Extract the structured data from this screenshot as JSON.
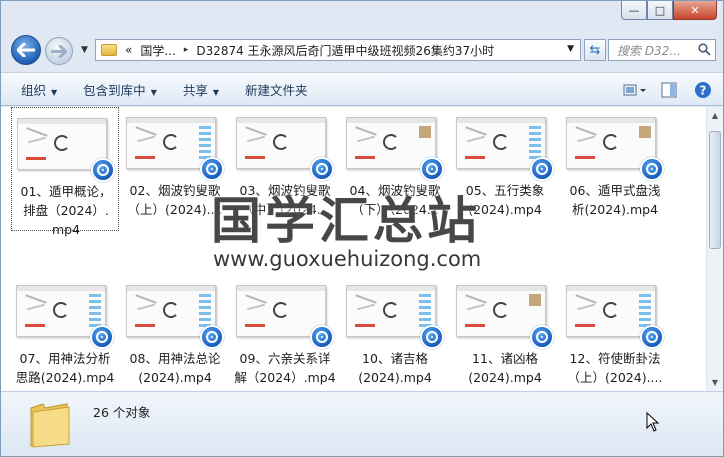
{
  "window": {
    "caption": {
      "minimize": "—",
      "maximize": "□",
      "close": "✕"
    }
  },
  "navigation": {
    "address_segments": [
      "«",
      "国学...",
      "▸",
      "D32874 王永源风后奇门遁甲中级班视频26集约37小时"
    ],
    "search_placeholder": "搜索 D32..."
  },
  "commandbar": {
    "items": [
      {
        "label": "组织",
        "caret": true
      },
      {
        "label": "包含到库中",
        "caret": true
      },
      {
        "label": "共享",
        "caret": true
      },
      {
        "label": "新建文件夹",
        "caret": false
      }
    ]
  },
  "files": [
    {
      "name": "01、遁甲概论，排盘（2024）.mp4",
      "lines": [
        "01、遁甲概论，",
        "排盘（2024）.",
        "mp4"
      ],
      "selected": true,
      "thumb": "plain"
    },
    {
      "name": "02",
      "lines": [
        "02、烟波钓叟歌",
        "（上）(2024)...."
      ],
      "selected": false,
      "thumb": "sidebar"
    },
    {
      "name": "03",
      "lines": [
        "03、烟波钓叟歌",
        "（中）（2024..."
      ],
      "selected": false,
      "thumb": "plain"
    },
    {
      "name": "04",
      "lines": [
        "04、烟波钓叟歌",
        "（下）（2024..."
      ],
      "selected": false,
      "thumb": "face"
    },
    {
      "name": "05",
      "lines": [
        "05、五行类象",
        "(2024).mp4"
      ],
      "selected": false,
      "thumb": "sidebar"
    },
    {
      "name": "06",
      "lines": [
        "06、遁甲式盘浅",
        "析(2024).mp4"
      ],
      "selected": false,
      "thumb": "face"
    },
    {
      "name": "07",
      "lines": [
        "07、用神法分析",
        "思路(2024).mp4"
      ],
      "selected": false,
      "thumb": "sidebar"
    },
    {
      "name": "08",
      "lines": [
        "08、用神法总论",
        "(2024).mp4"
      ],
      "selected": false,
      "thumb": "sidebar"
    },
    {
      "name": "09",
      "lines": [
        "09、六亲关系详",
        "解（2024）.mp4"
      ],
      "selected": false,
      "thumb": "plain"
    },
    {
      "name": "10",
      "lines": [
        "10、诸吉格",
        "(2024).mp4"
      ],
      "selected": false,
      "thumb": "sidebar"
    },
    {
      "name": "11",
      "lines": [
        "11、诸凶格",
        "(2024).mp4"
      ],
      "selected": false,
      "thumb": "face"
    },
    {
      "name": "12",
      "lines": [
        "12、符使断卦法",
        "（上）(2024)...."
      ],
      "selected": false,
      "thumb": "sidebar"
    }
  ],
  "watermark": {
    "title": "国学汇总站",
    "url": "www.guoxuehuizong.com"
  },
  "details": {
    "count": "26 个对象"
  },
  "colors": {
    "accent": "#1158b8",
    "chrome": "#dfe8f3",
    "selection_border": "#555555"
  }
}
